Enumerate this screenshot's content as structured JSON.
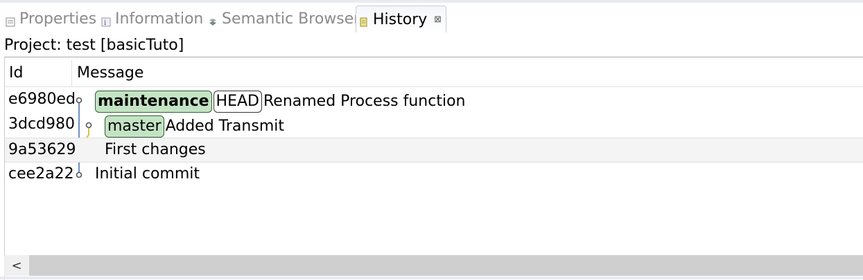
{
  "tabs": [
    {
      "label": "Properties",
      "icon": "properties-icon"
    },
    {
      "label": "Information",
      "icon": "information-icon"
    },
    {
      "label": "Semantic Browser",
      "icon": "semantic-browser-icon"
    },
    {
      "label": "History",
      "icon": "history-icon",
      "active": true
    }
  ],
  "close_glyph": "⊠",
  "project_label": "Project: test [basicTuto]",
  "columns": {
    "id": "Id",
    "message": "Message"
  },
  "rows": [
    {
      "id": "e6980ed",
      "refs": [
        {
          "label": "maintenance",
          "type": "branch",
          "bold": true
        },
        {
          "label": "HEAD",
          "type": "tag"
        }
      ],
      "message": "Renamed Process function"
    },
    {
      "id": "3dcd980",
      "refs": [
        {
          "label": "master",
          "type": "branch"
        }
      ],
      "message": "Added Transmit"
    },
    {
      "id": "9a53629",
      "refs": [],
      "message": "First changes",
      "selected": true
    },
    {
      "id": "cee2a22",
      "refs": [],
      "message": "Initial commit"
    }
  ],
  "scroll_left_glyph": "<",
  "colors": {
    "branch_bg": "#c4e3c4",
    "graph_blue": "#6f8fc8",
    "graph_yellow": "#d8c24a"
  }
}
